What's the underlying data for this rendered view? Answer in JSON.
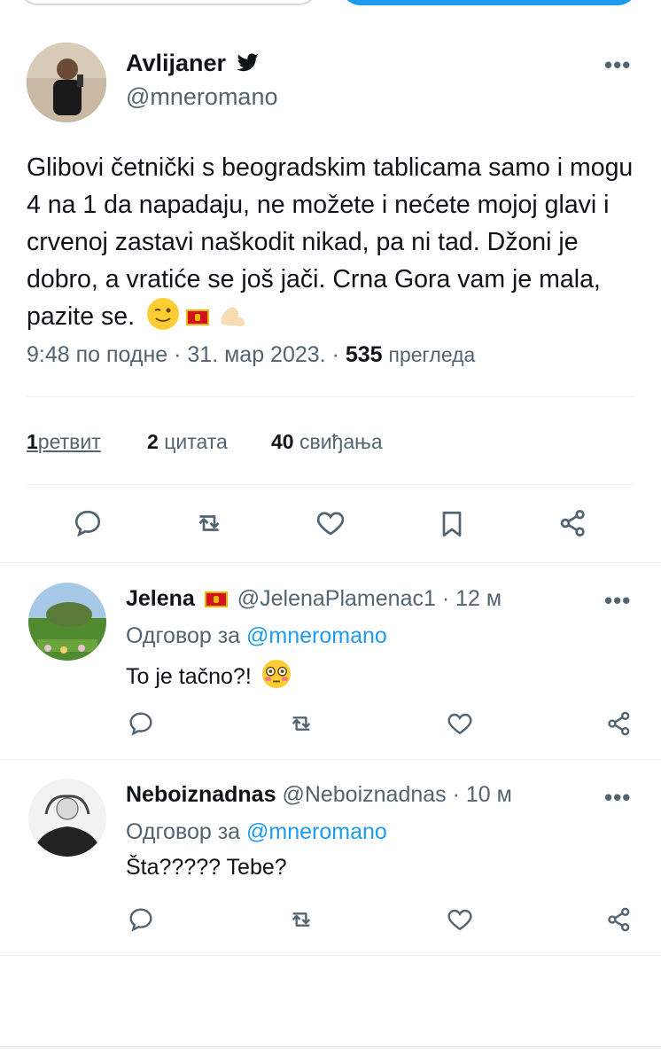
{
  "main_tweet": {
    "author_name": "Avlijaner",
    "handle": "@mneromano",
    "text": "Glibovi četnički s beogradskim tablicama samo i mogu 4 na 1 da napadaju, ne možete i nećete mojoj glavi i crvenoj zastavi naškodit nikad, pa ni tad. Džoni je dobro, a vratiće se još jači. Crna Gora vam je mala, pazite se.",
    "emojis": [
      "winking-face",
      "montenegro-flag",
      "flexed-biceps"
    ],
    "time": "9:48 по подне",
    "date": "31. мар 2023.",
    "views_count": "535",
    "views_label": "прегледа",
    "retweets_count": "1",
    "retweets_label": "ретвит",
    "quotes_count": "2",
    "quotes_label": "цитата",
    "likes_count": "40",
    "likes_label": "свиђања"
  },
  "replies": [
    {
      "author_name": "Jelena",
      "handle": "@JelenaPlamenac1",
      "time": "12 м",
      "reply_to_label": "Одговор за",
      "reply_to_handle": "@mneromano",
      "text": "To je tačno?!",
      "emoji": "flushed-face"
    },
    {
      "author_name": "Neboiznadnas",
      "handle": "@Neboiznadnas",
      "time": "10 м",
      "reply_to_label": "Одговор за",
      "reply_to_handle": "@mneromano",
      "text": "Šta????? Tebe?"
    }
  ],
  "colors": {
    "accent": "#1d9bf0",
    "text": "#0f1419",
    "secondary": "#536471",
    "divider": "#eff3f4"
  }
}
